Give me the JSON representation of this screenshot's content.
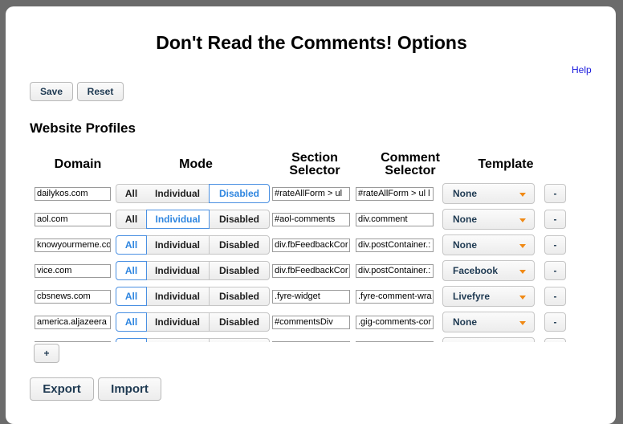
{
  "title": "Don't Read the Comments! Options",
  "help_label": "Help",
  "toolbar": {
    "save_label": "Save",
    "reset_label": "Reset"
  },
  "section_title": "Website Profiles",
  "columns": {
    "domain": "Domain",
    "mode": "Mode",
    "section_selector_1": "Section",
    "section_selector_2": "Selector",
    "comment_selector_1": "Comment",
    "comment_selector_2": "Selector",
    "template": "Template"
  },
  "mode_labels": {
    "all": "All",
    "individual": "Individual",
    "disabled": "Disabled"
  },
  "remove_label": "-",
  "add_label": "+",
  "footer": {
    "export_label": "Export",
    "import_label": "Import"
  },
  "colors": {
    "accent": "#2f86e0",
    "caret": "#f08a16",
    "help_link": "#1a1add"
  },
  "icons": {
    "template_dropdown": "chevron-down-icon"
  },
  "profiles": [
    {
      "domain": "dailykos.com",
      "mode": "disabled",
      "section": "#rateAllForm > ul",
      "comment": "#rateAllForm > ul l",
      "template": "None"
    },
    {
      "domain": "aol.com",
      "mode": "individual",
      "section": "#aol-comments",
      "comment": "div.comment",
      "template": "None"
    },
    {
      "domain": "knowyourmeme.co",
      "mode": "all",
      "section": "div.fbFeedbackCor",
      "comment": "div.postContainer.:",
      "template": "None"
    },
    {
      "domain": "vice.com",
      "mode": "all",
      "section": "div.fbFeedbackCor",
      "comment": "div.postContainer.:",
      "template": "Facebook"
    },
    {
      "domain": "cbsnews.com",
      "mode": "all",
      "section": ".fyre-widget",
      "comment": ".fyre-comment-wra",
      "template": "Livefyre"
    },
    {
      "domain": "america.aljazeera",
      "mode": "all",
      "section": "#commentsDiv",
      "comment": ".gig-comments-cor",
      "template": "None"
    },
    {
      "domain": "",
      "mode": "all",
      "section": "",
      "comment": "",
      "template": ""
    }
  ]
}
